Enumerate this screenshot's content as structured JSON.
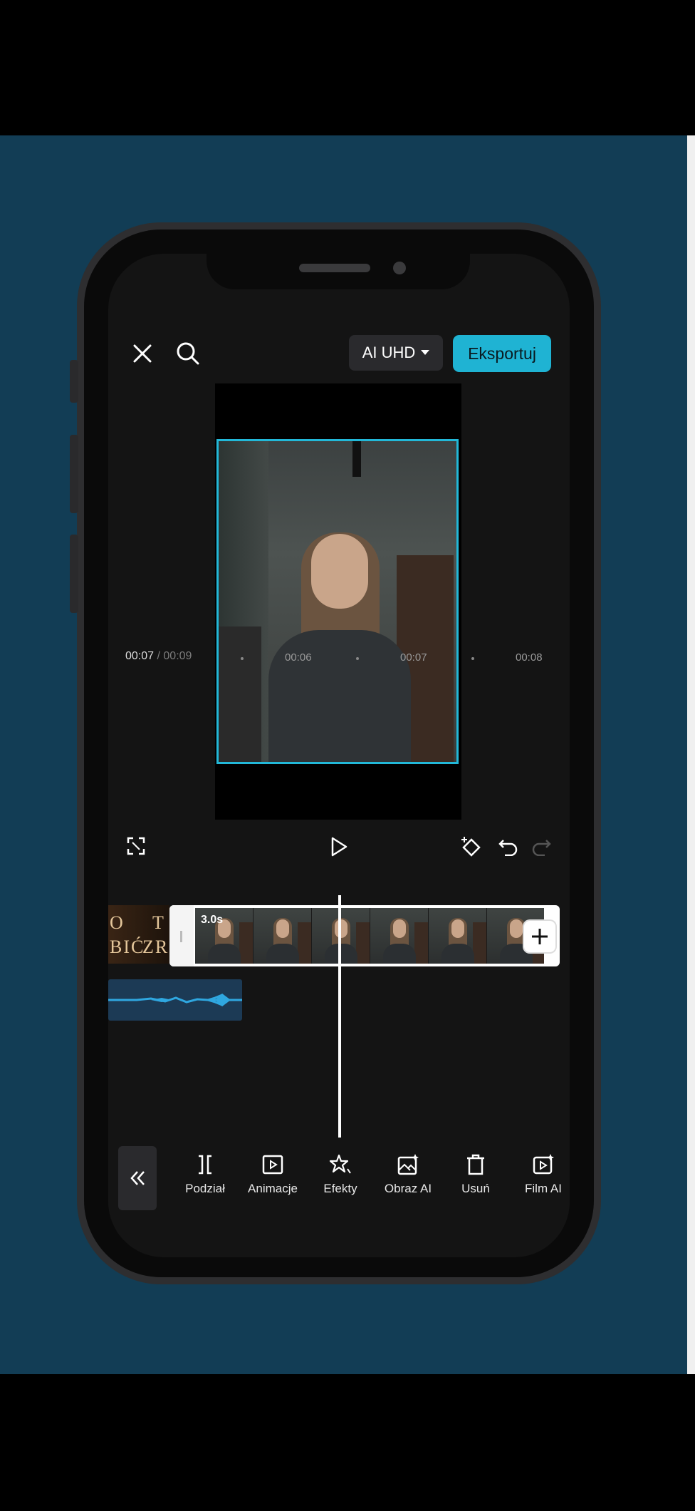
{
  "header": {
    "ai_uhd_label": "AI UHD",
    "export_label": "Eksportuj"
  },
  "playback": {
    "current_time": "00:07",
    "separator": "/",
    "total_time": "00:09"
  },
  "ruler": {
    "ticks": [
      "00:06",
      "00:07",
      "00:08"
    ]
  },
  "timeline": {
    "title_clip_text": [
      "O",
      "T",
      "BIĆ",
      "ZRO"
    ],
    "video_clip_duration": "3.0s"
  },
  "toolbar": {
    "items": [
      {
        "label": "Podział",
        "icon": "split-icon"
      },
      {
        "label": "Animacje",
        "icon": "animation-icon"
      },
      {
        "label": "Efekty",
        "icon": "effects-icon"
      },
      {
        "label": "Obraz AI",
        "icon": "ai-image-icon"
      },
      {
        "label": "Usuń",
        "icon": "delete-icon"
      },
      {
        "label": "Film AI",
        "icon": "ai-film-icon"
      }
    ]
  },
  "colors": {
    "accent": "#1fb3d3",
    "grid_background": "#123d55",
    "grid_lines": "#2da6bd",
    "screen_background": "#141414"
  }
}
